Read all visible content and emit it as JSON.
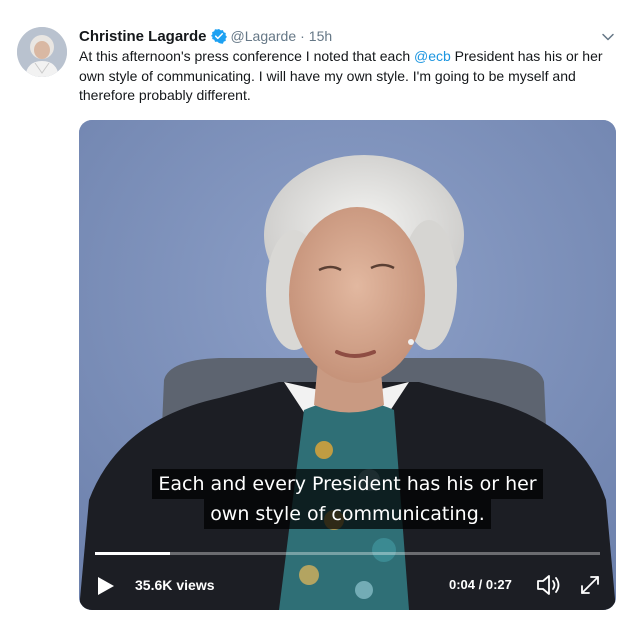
{
  "tweet": {
    "author": {
      "display_name": "Christine Lagarde",
      "handle": "@Lagarde",
      "separator": "·",
      "time": "15h",
      "verified": true,
      "avatar_icon": "profile-avatar"
    },
    "text_parts": {
      "before_mention": "At this afternoon's press conference I noted that each ",
      "mention": "@ecb",
      "after_mention": " President has his or her own style of communicating. I will have my own style. I'm going to be myself and therefore probably different."
    },
    "menu_icon": "chevron-down-icon"
  },
  "video": {
    "subtitle_line1": "Each and every President has his or her",
    "subtitle_line2": "own style of communicating.",
    "views_count": "35.6K",
    "views_label": "views",
    "current_time": "0:04",
    "time_separator": " / ",
    "duration": "0:27",
    "progress_fraction": 0.148,
    "play_icon": "play-icon",
    "volume_icon": "volume-icon",
    "fullscreen_icon": "fullscreen-icon"
  },
  "colors": {
    "link": "#1b95e0",
    "verified": "#1da1f2",
    "text": "#14171a",
    "muted": "#657786",
    "video_background": "#7a8db7"
  }
}
